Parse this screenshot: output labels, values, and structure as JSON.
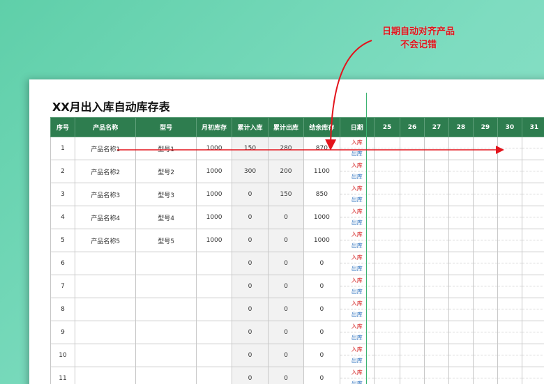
{
  "callout": {
    "line1": "日期自动对齐产品",
    "line2": "不会记错"
  },
  "sheet": {
    "title": "XX月出入库自动库存表"
  },
  "table": {
    "headers": [
      "序号",
      "产品名称",
      "型号",
      "月初库存",
      "累计入库",
      "累计出库",
      "结余库存",
      "日期"
    ],
    "days": [
      "25",
      "26",
      "27",
      "28",
      "29",
      "30",
      "31"
    ],
    "in_label": "入库",
    "out_label": "出库",
    "rows": [
      {
        "no": "1",
        "name": "产品名称1",
        "model": "型号1",
        "open": "1000",
        "cin": "150",
        "cout": "280",
        "bal": "870"
      },
      {
        "no": "2",
        "name": "产品名称2",
        "model": "型号2",
        "open": "1000",
        "cin": "300",
        "cout": "200",
        "bal": "1100"
      },
      {
        "no": "3",
        "name": "产品名称3",
        "model": "型号3",
        "open": "1000",
        "cin": "0",
        "cout": "150",
        "bal": "850"
      },
      {
        "no": "4",
        "name": "产品名称4",
        "model": "型号4",
        "open": "1000",
        "cin": "0",
        "cout": "0",
        "bal": "1000"
      },
      {
        "no": "5",
        "name": "产品名称5",
        "model": "型号5",
        "open": "1000",
        "cin": "0",
        "cout": "0",
        "bal": "1000"
      },
      {
        "no": "6",
        "name": "",
        "model": "",
        "open": "",
        "cin": "0",
        "cout": "0",
        "bal": "0"
      },
      {
        "no": "7",
        "name": "",
        "model": "",
        "open": "",
        "cin": "0",
        "cout": "0",
        "bal": "0"
      },
      {
        "no": "8",
        "name": "",
        "model": "",
        "open": "",
        "cin": "0",
        "cout": "0",
        "bal": "0"
      },
      {
        "no": "9",
        "name": "",
        "model": "",
        "open": "",
        "cin": "0",
        "cout": "0",
        "bal": "0"
      },
      {
        "no": "10",
        "name": "",
        "model": "",
        "open": "",
        "cin": "0",
        "cout": "0",
        "bal": "0"
      },
      {
        "no": "11",
        "name": "",
        "model": "",
        "open": "",
        "cin": "0",
        "cout": "0",
        "bal": "0"
      }
    ]
  },
  "colors": {
    "header": "#2e7d4f",
    "in": "#d42020",
    "out": "#2a6fbd",
    "arrow": "#e3141c"
  },
  "icons": {
    "callout_arrow": "curved-arrow-icon",
    "row_arrow": "horizontal-arrow-icon"
  }
}
